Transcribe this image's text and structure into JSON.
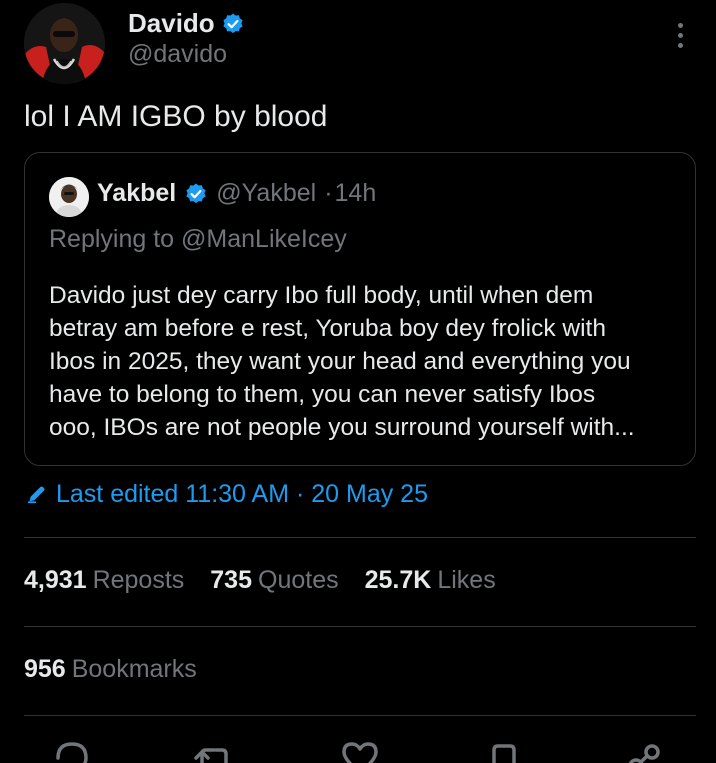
{
  "author": {
    "name": "Davido",
    "handle": "@davido",
    "verified": true
  },
  "tweet": {
    "text": "lol I AM IGBO by blood"
  },
  "quote": {
    "name": "Yakbel",
    "handle": "@Yakbel",
    "separator": "·",
    "time": "14h",
    "replying_prefix": "Replying to ",
    "replying_to": "@ManLikeIcey",
    "body_lines": [
      "Davido just dey carry Ibo full body, until when dem",
      "betray am before e rest, Yoruba boy dey frolick with",
      "Ibos in 2025, they want your head and everything you",
      "have to belong to them, you can never satisfy Ibos",
      "ooo, IBOs are not people you surround yourself with..."
    ]
  },
  "edited": {
    "label": "Last edited 11:30 AM · 20 May 25"
  },
  "stats": {
    "reposts": {
      "num": "4,931",
      "label": "Reposts"
    },
    "quotes": {
      "num": "735",
      "label": "Quotes"
    },
    "likes": {
      "num": "25.7K",
      "label": "Likes"
    },
    "bookmarks": {
      "num": "956",
      "label": "Bookmarks"
    }
  },
  "icons": {
    "verified": "verified-badge-icon",
    "more": "more-vertical-icon",
    "edit": "pencil-icon",
    "reply": "reply-icon",
    "repost": "repost-icon",
    "like": "heart-icon",
    "bookmark": "bookmark-icon",
    "share": "share-icon"
  },
  "colors": {
    "background": "#000000",
    "text": "#e7e9ea",
    "muted": "#71767b",
    "accent": "#1d9bf0",
    "border": "#2f3336"
  }
}
